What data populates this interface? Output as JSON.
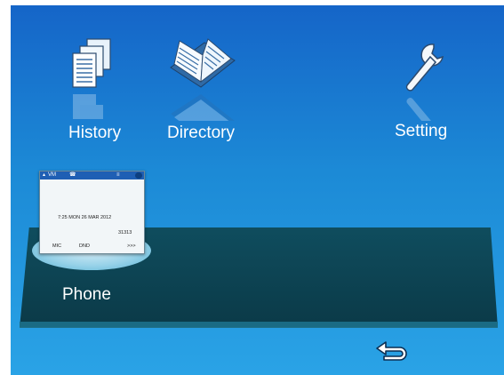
{
  "apps": {
    "history": {
      "label": "History",
      "icon": "history-documents-icon"
    },
    "directory": {
      "label": "Directory",
      "icon": "directory-book-icon"
    },
    "setting": {
      "label": "Setting",
      "icon": "wrench-icon"
    }
  },
  "phone": {
    "label": "Phone",
    "preview": {
      "status_left": "VM",
      "datetime": "7:25  MON  26  MAR  2012",
      "number": "31313",
      "soft_keys": [
        "MIC",
        "DND",
        ">>>"
      ]
    }
  },
  "back": {
    "icon": "back-arrow-icon"
  },
  "colors": {
    "background": "#1c8ad6",
    "tray": "#0b3a48"
  }
}
